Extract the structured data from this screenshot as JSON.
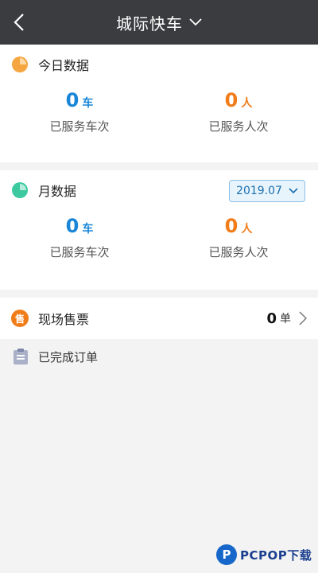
{
  "nav": {
    "title": "城际快车"
  },
  "today": {
    "label": "今日数据",
    "stats": [
      {
        "value": "0",
        "unit": "车",
        "desc": "已服务车次"
      },
      {
        "value": "0",
        "unit": "人",
        "desc": "已服务人次"
      }
    ]
  },
  "month": {
    "label": "月数据",
    "selected": "2019.07",
    "stats": [
      {
        "value": "0",
        "unit": "车",
        "desc": "已服务车次"
      },
      {
        "value": "0",
        "unit": "人",
        "desc": "已服务人次"
      }
    ]
  },
  "onsite": {
    "icon_char": "售",
    "label": "现场售票",
    "count": "0",
    "unit": "单"
  },
  "completed": {
    "label": "已完成订单"
  },
  "watermark": {
    "text": "PCPOP下载"
  },
  "colors": {
    "nav_bg": "#3a3c3f",
    "blue": "#1a86d8",
    "orange": "#f07d1a",
    "teal": "#3cc9a0"
  }
}
